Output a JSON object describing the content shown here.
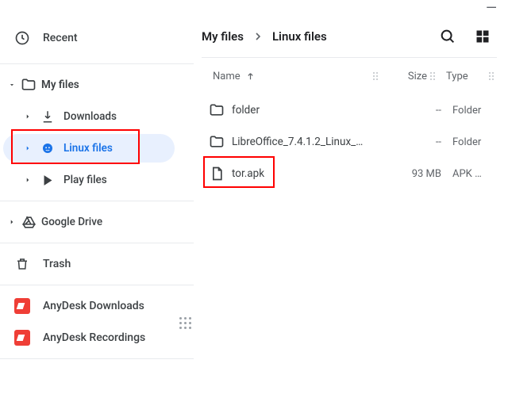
{
  "window": {
    "minimize": "—"
  },
  "sidebar": {
    "recent": "Recent",
    "myfiles": "My files",
    "downloads": "Downloads",
    "linux": "Linux files",
    "play": "Play files",
    "gdrive": "Google Drive",
    "trash": "Trash",
    "anydesk_dl": "AnyDesk Downloads",
    "anydesk_rec": "AnyDesk Recordings"
  },
  "breadcrumb": {
    "root": "My files",
    "current": "Linux files"
  },
  "columns": {
    "name": "Name",
    "size": "Size",
    "type": "Type"
  },
  "rows": [
    {
      "name": "folder",
      "size": "--",
      "type": "Folder",
      "icon": "folder"
    },
    {
      "name": "LibreOffice_7.4.1.2_Linux_…",
      "size": "--",
      "type": "Folder",
      "icon": "folder"
    },
    {
      "name": "tor.apk",
      "size": "93 MB",
      "type": "APK …",
      "icon": "file"
    }
  ],
  "highlights": {
    "sidebar_linux": true,
    "file_tor": true
  }
}
